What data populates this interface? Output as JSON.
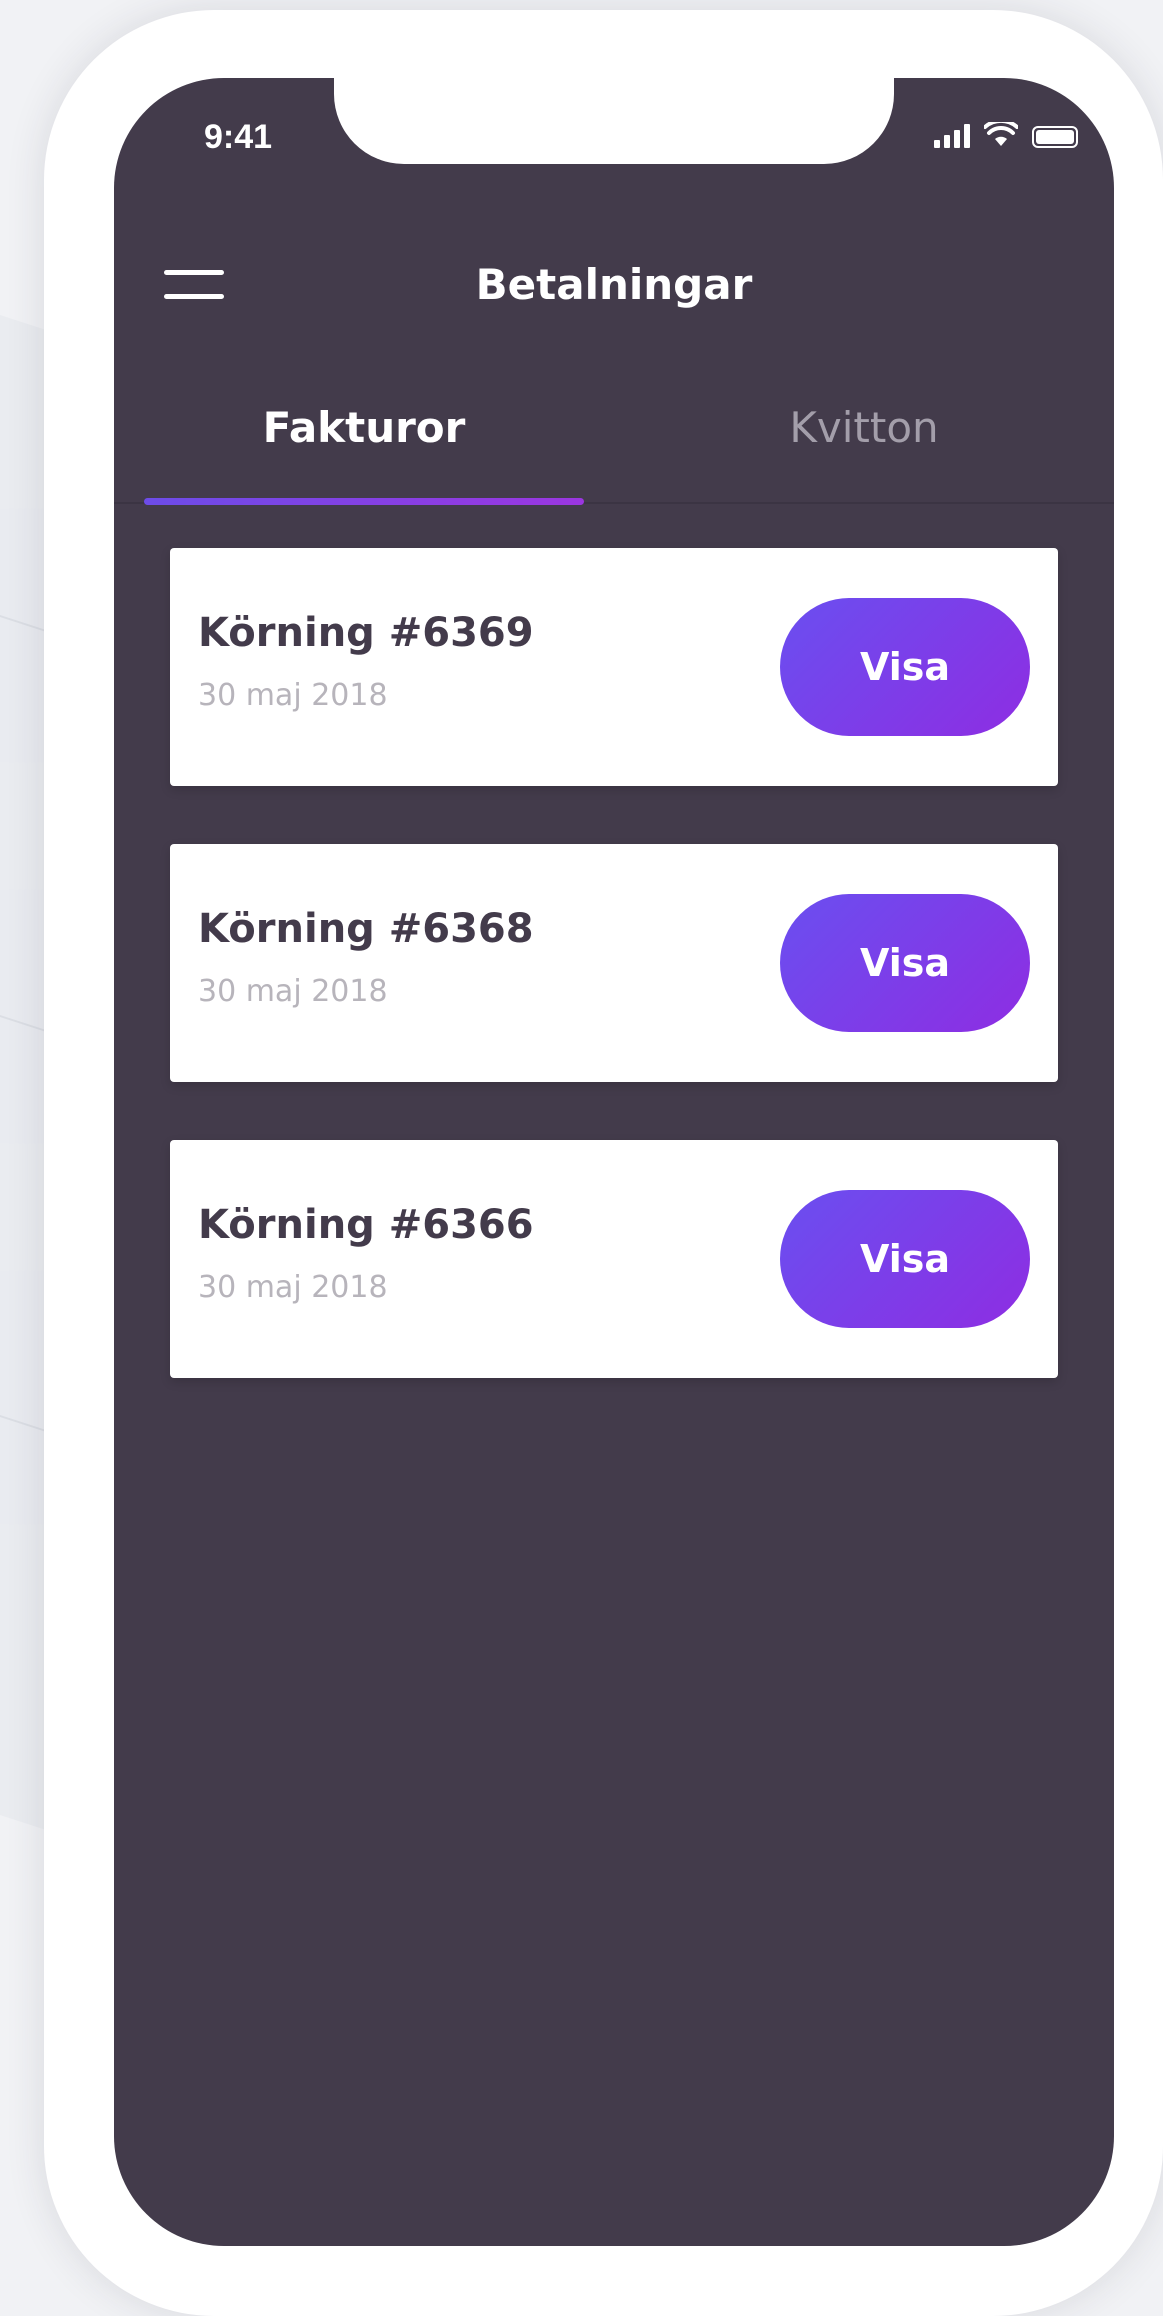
{
  "status_bar": {
    "time": "9:41",
    "icons": [
      "signal-icon",
      "wifi-icon",
      "battery-icon"
    ]
  },
  "header": {
    "title": "Betalningar",
    "menu_icon": "hamburger-icon"
  },
  "tabs": [
    {
      "label": "Fakturor",
      "active": true
    },
    {
      "label": "Kvitton",
      "active": false
    }
  ],
  "invoices": [
    {
      "title": "Körning #6369",
      "date": "30 maj 2018",
      "button": "Visa"
    },
    {
      "title": "Körning #6368",
      "date": "30 maj 2018",
      "button": "Visa"
    },
    {
      "title": "Körning #6366",
      "date": "30 maj 2018",
      "button": "Visa"
    }
  ],
  "colors": {
    "screen_bg": "#433b4b",
    "accent_start": "#6a4ff0",
    "accent_end": "#8e2de2",
    "card_bg": "#ffffff",
    "inactive_tab": "#a39eaa"
  }
}
